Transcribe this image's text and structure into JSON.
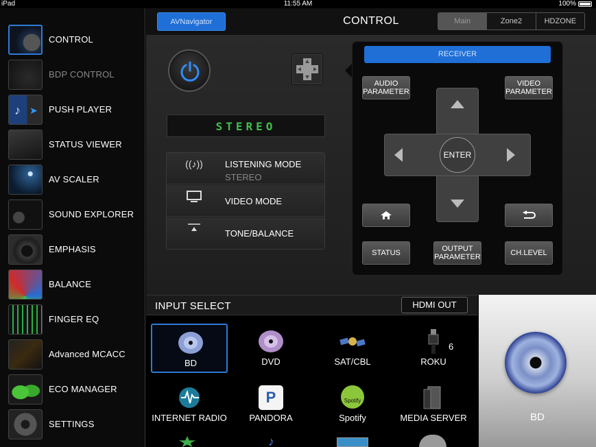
{
  "status_bar": {
    "device": "iPad",
    "time": "11:55 AM",
    "battery": "100%"
  },
  "sidebar": {
    "items": [
      {
        "label": "CONTROL"
      },
      {
        "label": "BDP CONTROL"
      },
      {
        "label": "PUSH PLAYER"
      },
      {
        "label": "STATUS VIEWER"
      },
      {
        "label": "AV SCALER"
      },
      {
        "label": "SOUND EXPLORER"
      },
      {
        "label": "EMPHASIS"
      },
      {
        "label": "BALANCE"
      },
      {
        "label": "FINGER EQ"
      },
      {
        "label": "Advanced MCACC"
      },
      {
        "label": "ECO MANAGER"
      },
      {
        "label": "SETTINGS"
      }
    ]
  },
  "header": {
    "av_navigator": "AVNavigator",
    "title": "CONTROL",
    "zones": [
      "Main",
      "Zone2",
      "HDZONE"
    ]
  },
  "display": {
    "mode": "STEREO"
  },
  "modes": {
    "listening": {
      "label": "LISTENING MODE",
      "value": "STEREO"
    },
    "video": {
      "label": "VIDEO MODE"
    },
    "tone": {
      "label": "TONE/BALANCE"
    }
  },
  "receiver": {
    "title": "RECEIVER",
    "audio_parameter": [
      "AUDIO",
      "PARAMETER"
    ],
    "video_parameter": [
      "VIDEO",
      "PARAMETER"
    ],
    "enter": "ENTER",
    "status": "STATUS",
    "output_parameter": [
      "OUTPUT",
      "PARAMETER"
    ],
    "ch_level": "CH.LEVEL"
  },
  "input_select": {
    "title": "INPUT SELECT",
    "hdmi_out": "HDMI OUT",
    "inputs": [
      {
        "label": "BD",
        "icon": "disc-icon"
      },
      {
        "label": "DVD",
        "icon": "disc-icon"
      },
      {
        "label": "SAT/CBL",
        "icon": "satellite-icon"
      },
      {
        "label": "ROKU",
        "icon": "hdmi-plug-icon",
        "badge": "6"
      },
      {
        "label": "INTERNET RADIO",
        "icon": "globe-icon"
      },
      {
        "label": "PANDORA",
        "icon": "pandora-icon",
        "glyph": "P"
      },
      {
        "label": "Spotify",
        "icon": "spotify-icon",
        "glyph": "Spotify"
      },
      {
        "label": "MEDIA SERVER",
        "icon": "server-icon"
      }
    ],
    "selected": "BD"
  },
  "colors": {
    "accent": "#1f6fd6",
    "display_green": "#3fc04a"
  }
}
